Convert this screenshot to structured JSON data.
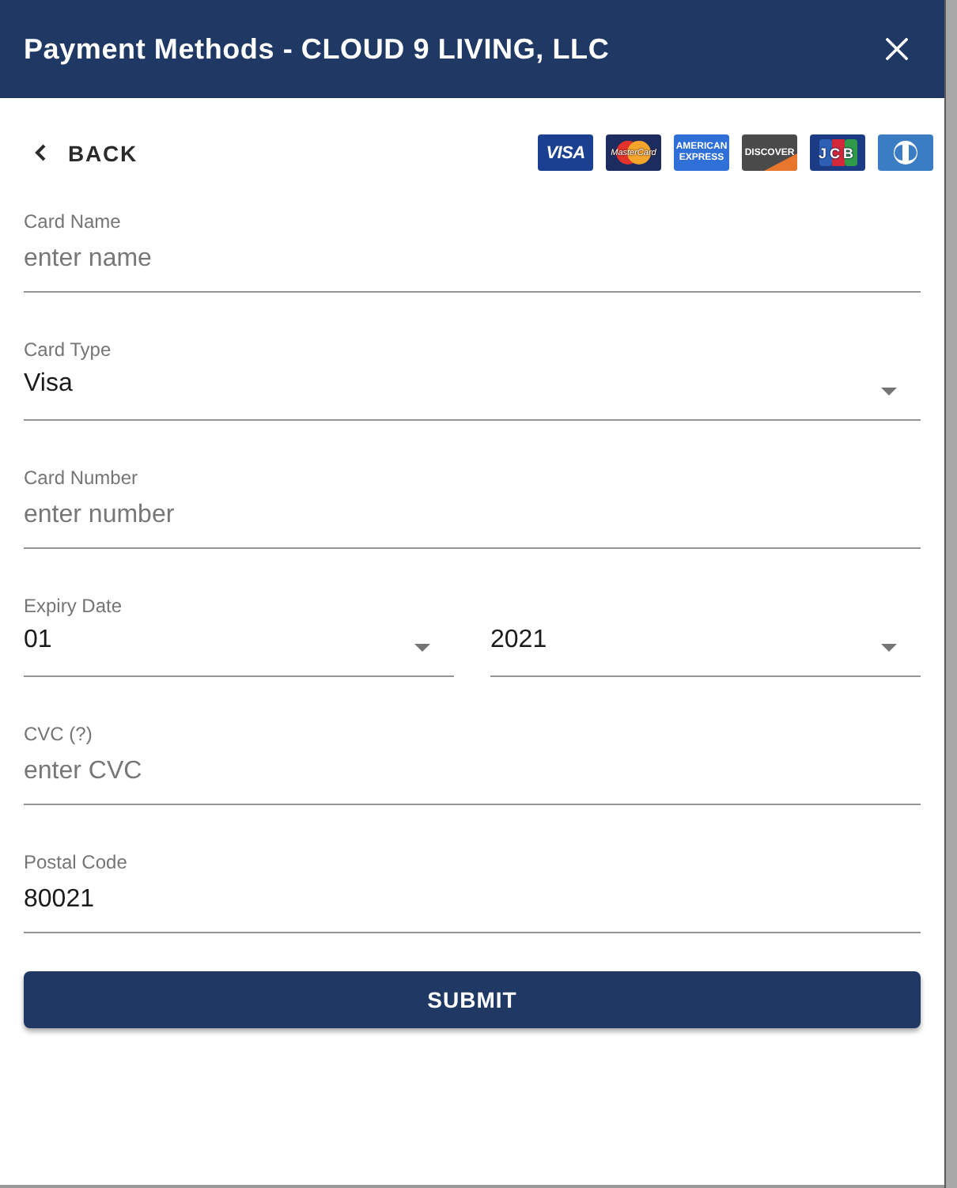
{
  "dialog": {
    "title": "Payment Methods - CLOUD 9 LIVING, LLC"
  },
  "back": {
    "label": "BACK"
  },
  "card_logos": [
    {
      "kind": "visa",
      "label": "VISA"
    },
    {
      "kind": "mastercard",
      "label": "MasterCard"
    },
    {
      "kind": "amex",
      "label": "AMERICAN EXPRESS"
    },
    {
      "kind": "discover",
      "label": "DISCOVER"
    },
    {
      "kind": "jcb",
      "label": "JCB"
    },
    {
      "kind": "diners"
    }
  ],
  "fields": [
    {
      "kind": "text",
      "label": "Card Name",
      "placeholder": "enter name"
    },
    {
      "kind": "select",
      "label": "Card Type",
      "value": "Visa"
    },
    {
      "kind": "text",
      "label": "Card Number",
      "placeholder": "enter number"
    },
    {
      "kind": "select_pair",
      "label": "Expiry Date",
      "selects": [
        {
          "value": "01"
        },
        {
          "value": "2021"
        }
      ]
    },
    {
      "kind": "text",
      "label": "CVC (?)",
      "placeholder": "enter CVC"
    },
    {
      "kind": "text",
      "label": "Postal Code",
      "value": "80021"
    }
  ],
  "submit": {
    "label": "SUBMIT"
  }
}
